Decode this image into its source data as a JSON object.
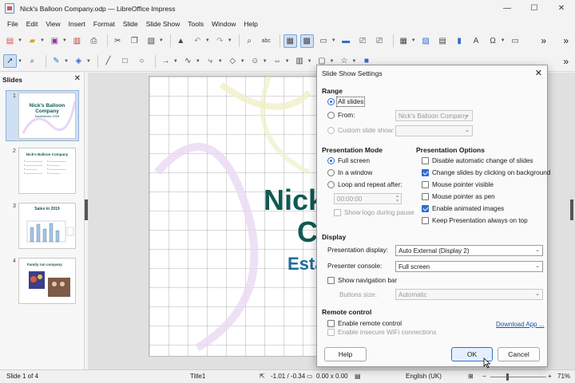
{
  "window": {
    "title": "Nick's Balloon Company.odp — LibreOffice Impress",
    "minimize_icon": "minimize-icon",
    "maximize_icon": "maximize-icon",
    "close_icon": "close-icon"
  },
  "menu": [
    "File",
    "Edit",
    "View",
    "Insert",
    "Format",
    "Slide",
    "Slide Show",
    "Tools",
    "Window",
    "Help"
  ],
  "slides_panel": {
    "title": "Slides",
    "slides": [
      {
        "number": "1",
        "title": "Nick's Balloon Company",
        "subtitle": "Established 2006"
      },
      {
        "number": "2",
        "title": "Nick's Balloon Company"
      },
      {
        "number": "3",
        "title": "Sales in 2019"
      },
      {
        "number": "4",
        "title": "Family run company"
      }
    ]
  },
  "slide_canvas": {
    "title_line1": "Nick",
    "title_line2": "Co",
    "subtitle": "Esta"
  },
  "status": {
    "slide": "Slide 1 of 4",
    "layout": "Title1",
    "position": "-1.01 / -0.34",
    "size": "0.00 x 0.00",
    "language": "English (UK)",
    "zoom": "71%"
  },
  "dialog": {
    "title": "Slide Show Settings",
    "range": {
      "heading": "Range",
      "all_slides": "All slides",
      "from": "From:",
      "from_value": "Nick's Balloon Company",
      "custom": "Custom slide show:",
      "custom_value": ""
    },
    "mode": {
      "heading": "Presentation Mode",
      "full_screen": "Full screen",
      "in_window": "In a window",
      "loop": "Loop and repeat after:",
      "loop_time": "00:00:00",
      "show_logo": "Show logo during pause"
    },
    "options": {
      "heading": "Presentation Options",
      "items": [
        {
          "label": "Disable automatic change of slides",
          "checked": false
        },
        {
          "label": "Change slides by clicking on background",
          "checked": true
        },
        {
          "label": "Mouse pointer visible",
          "checked": false
        },
        {
          "label": "Mouse pointer as pen",
          "checked": false
        },
        {
          "label": "Enable animated images",
          "checked": true
        },
        {
          "label": "Keep Presentation always on top",
          "checked": false
        }
      ]
    },
    "display": {
      "heading": "Display",
      "presentation_display_label": "Presentation display:",
      "presentation_display_value": "Auto External (Display 2)",
      "presenter_console_label": "Presenter console:",
      "presenter_console_value": "Full screen",
      "show_nav_bar": "Show navigation bar",
      "buttons_size_label": "Buttons size:",
      "buttons_size_value": "Automatic"
    },
    "remote": {
      "heading": "Remote control",
      "enable_remote": "Enable remote control",
      "enable_insecure": "Enable insecure WiFi connections",
      "download_link": "Download App ..."
    },
    "buttons": {
      "help": "Help",
      "ok": "OK",
      "cancel": "Cancel"
    }
  },
  "colors": {
    "accent": "#2f6fd0",
    "slide_title": "#0f5a55",
    "slide_subtitle": "#1b6e9c"
  }
}
